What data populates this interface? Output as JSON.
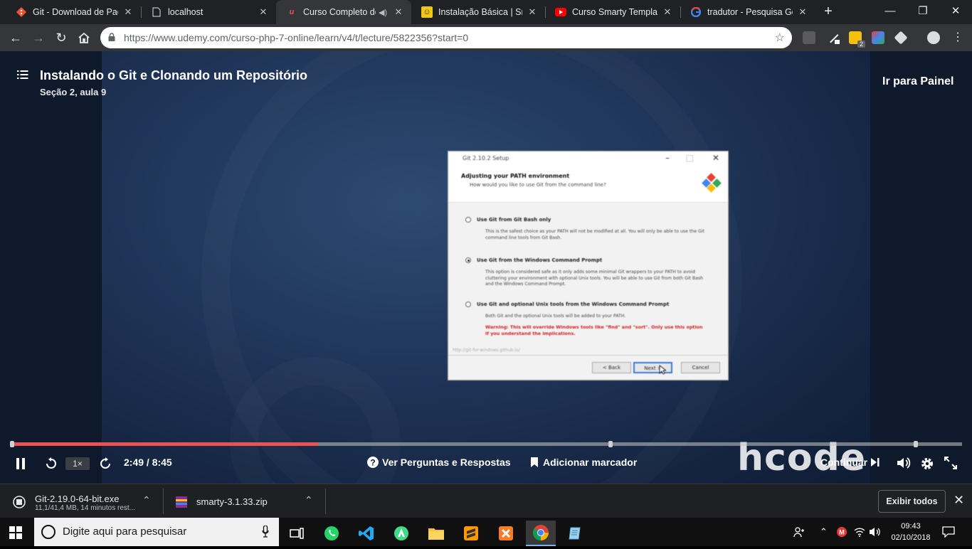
{
  "browser": {
    "tabs": [
      {
        "title": "Git - Download de Paco",
        "icon": "git-favicon",
        "active": false
      },
      {
        "title": "localhost",
        "icon": "page-icon",
        "active": false
      },
      {
        "title": "Curso Completo de",
        "icon": "udemy-favicon",
        "active": true
      },
      {
        "title": "Instalação Básica | Smar",
        "icon": "smarty-favicon",
        "active": false
      },
      {
        "title": "Curso Smarty Template",
        "icon": "youtube-favicon",
        "active": false
      },
      {
        "title": "tradutor - Pesquisa Goo",
        "icon": "google-favicon",
        "active": false
      }
    ],
    "url": "https://www.udemy.com/curso-php-7-online/learn/v4/t/lecture/5822356?start=0",
    "download_badge_count": "2"
  },
  "player": {
    "lecture_title": "Instalando o Git e Clonando um Repositório",
    "lecture_subtitle": "Seção 2, aula 9",
    "dashboard_link": "Ir para Painel",
    "current_time": "2:49",
    "duration": "8:45",
    "time_display": "2:49 / 8:45",
    "progress_fraction": 0.322,
    "speed": "1×",
    "qa_label": "Ver Perguntas e Respostas",
    "bookmark_label": "Adicionar marcador",
    "continue_label": "Continuar",
    "watermark": "hcode",
    "accent_color": "#ec5252"
  },
  "video_dialog": {
    "window_title": "Git 2.10.2 Setup",
    "heading": "Adjusting your PATH environment",
    "subheading": "How would you like to use Git from the command line?",
    "options": [
      {
        "label": "Use Git from Git Bash only",
        "selected": false,
        "desc": "This is the safest choice as your PATH will not be modified at all. You will only be able to use the Git command line tools from Git Bash."
      },
      {
        "label": "Use Git from the Windows Command Prompt",
        "selected": true,
        "desc": "This option is considered safe as it only adds some minimal Git wrappers to your PATH to avoid cluttering your environment with optional Unix tools. You will be able to use Git from both Git Bash and the Windows Command Prompt."
      },
      {
        "label": "Use Git and optional Unix tools from the Windows Command Prompt",
        "selected": false,
        "desc": "Both Git and the optional Unix tools will be added to your PATH.",
        "warning": "Warning: This will override Windows tools like \"find\" and \"sort\". Only use this option if you understand the implications."
      }
    ],
    "footnote": "http://git-for-windows.github.io/",
    "back": "< Back",
    "next": "Next >",
    "cancel": "Cancel"
  },
  "downloads": [
    {
      "name": "Git-2.19.0-64-bit.exe",
      "status": "11,1/41,4 MB, 14 minutos rest..."
    },
    {
      "name": "smarty-3.1.33.zip",
      "status": ""
    }
  ],
  "downloads_show_all": "Exibir todos",
  "taskbar": {
    "search_placeholder": "Digite aqui para pesquisar",
    "apps": [
      "task-view",
      "whatsapp",
      "vscode",
      "android-studio",
      "file-explorer",
      "sublime-text",
      "xampp",
      "chrome",
      "notepad"
    ],
    "time": "09:43",
    "date": "02/10/2018"
  }
}
